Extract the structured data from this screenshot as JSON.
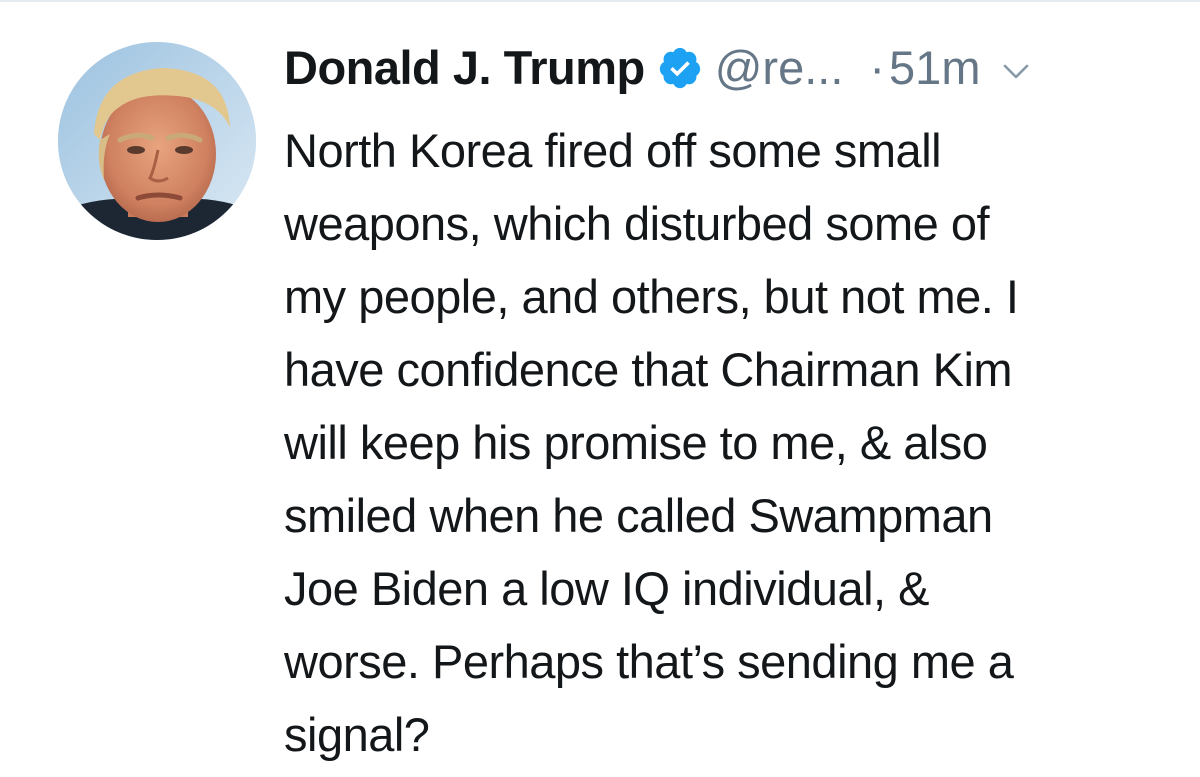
{
  "tweet": {
    "author": {
      "display_name": "Donald J. Trump",
      "verified": true,
      "handle": "@re...",
      "avatar_icon": "user-avatar-photo"
    },
    "timestamp_separator": "·",
    "timestamp": "51m",
    "menu_icon": "chevron-down-icon",
    "verified_icon": "verified-badge-icon",
    "text_lines": [
      "North Korea fired off some small",
      "weapons, which disturbed some of",
      "my people, and others, but not me. I",
      "have confidence that Chairman Kim",
      "will keep his promise to me, & also",
      "smiled when he called Swampman",
      "Joe Biden a low IQ individual, &",
      "worse. Perhaps that’s sending me a",
      "signal?"
    ]
  },
  "colors": {
    "text_primary": "#14171a",
    "text_secondary": "#657786",
    "verified_blue": "#1da1f2",
    "divider": "#e6ecf0"
  }
}
